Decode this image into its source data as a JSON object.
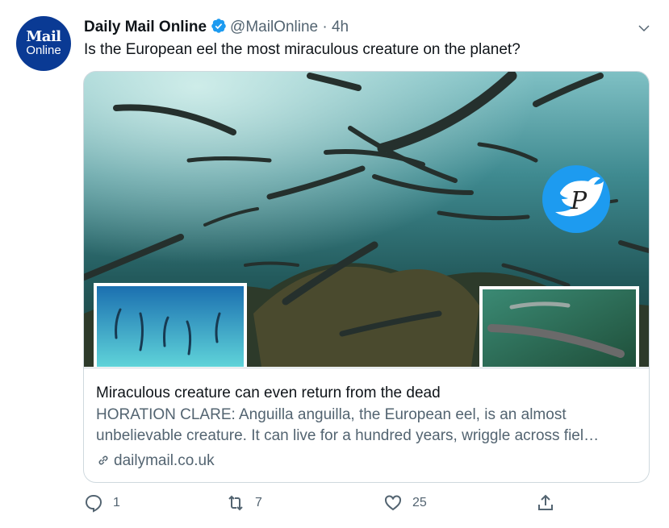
{
  "account": {
    "avatar_line1": "Mail",
    "avatar_line2": "Online",
    "name": "Daily Mail Online",
    "handle": "@MailOnline",
    "separator": "·",
    "time": "4h"
  },
  "tweet": {
    "text": "Is the European eel the most miraculous creature on the planet?"
  },
  "card": {
    "title": "Miraculous creature can even return from the dead",
    "description": "HORATION CLARE: Anguilla anguilla, the European eel, is an almost unbelievable creature. It can live for a hundred years, wriggle across fiel…",
    "domain": "dailymail.co.uk",
    "watermark_letter": "P"
  },
  "actions": {
    "reply_count": "1",
    "retweet_count": "7",
    "like_count": "25"
  },
  "colors": {
    "avatar_bg": "#0a3a94",
    "verified": "#1d9bf0",
    "muted_text": "#536471",
    "water_top": "#5fa7b0",
    "water_bottom": "#1c4a4e"
  },
  "icons": [
    "verified-badge-icon",
    "chevron-down-icon",
    "link-icon",
    "reply-icon",
    "retweet-icon",
    "like-icon",
    "share-icon",
    "twitter-bird-icon"
  ]
}
